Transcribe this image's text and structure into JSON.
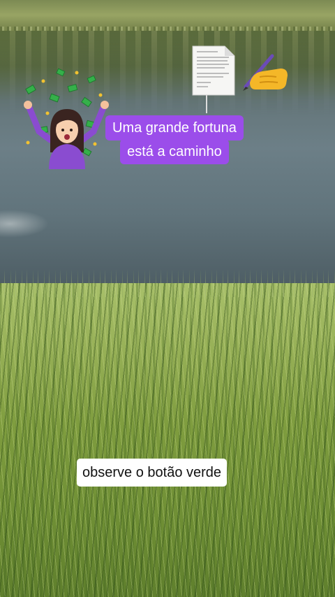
{
  "overlay": {
    "caption_line_1": "Uma grande fortuna",
    "caption_line_2": "está a caminho",
    "hint_text": "observe o botão verde"
  },
  "colors": {
    "caption_background": "#9b4dea",
    "caption_text": "#ffffff",
    "hint_background": "#ffffff",
    "hint_text": "#111111"
  },
  "icons": {
    "woman": "woman-money-rain-icon",
    "document": "document-icon",
    "writing_hand": "writing-hand-icon"
  }
}
